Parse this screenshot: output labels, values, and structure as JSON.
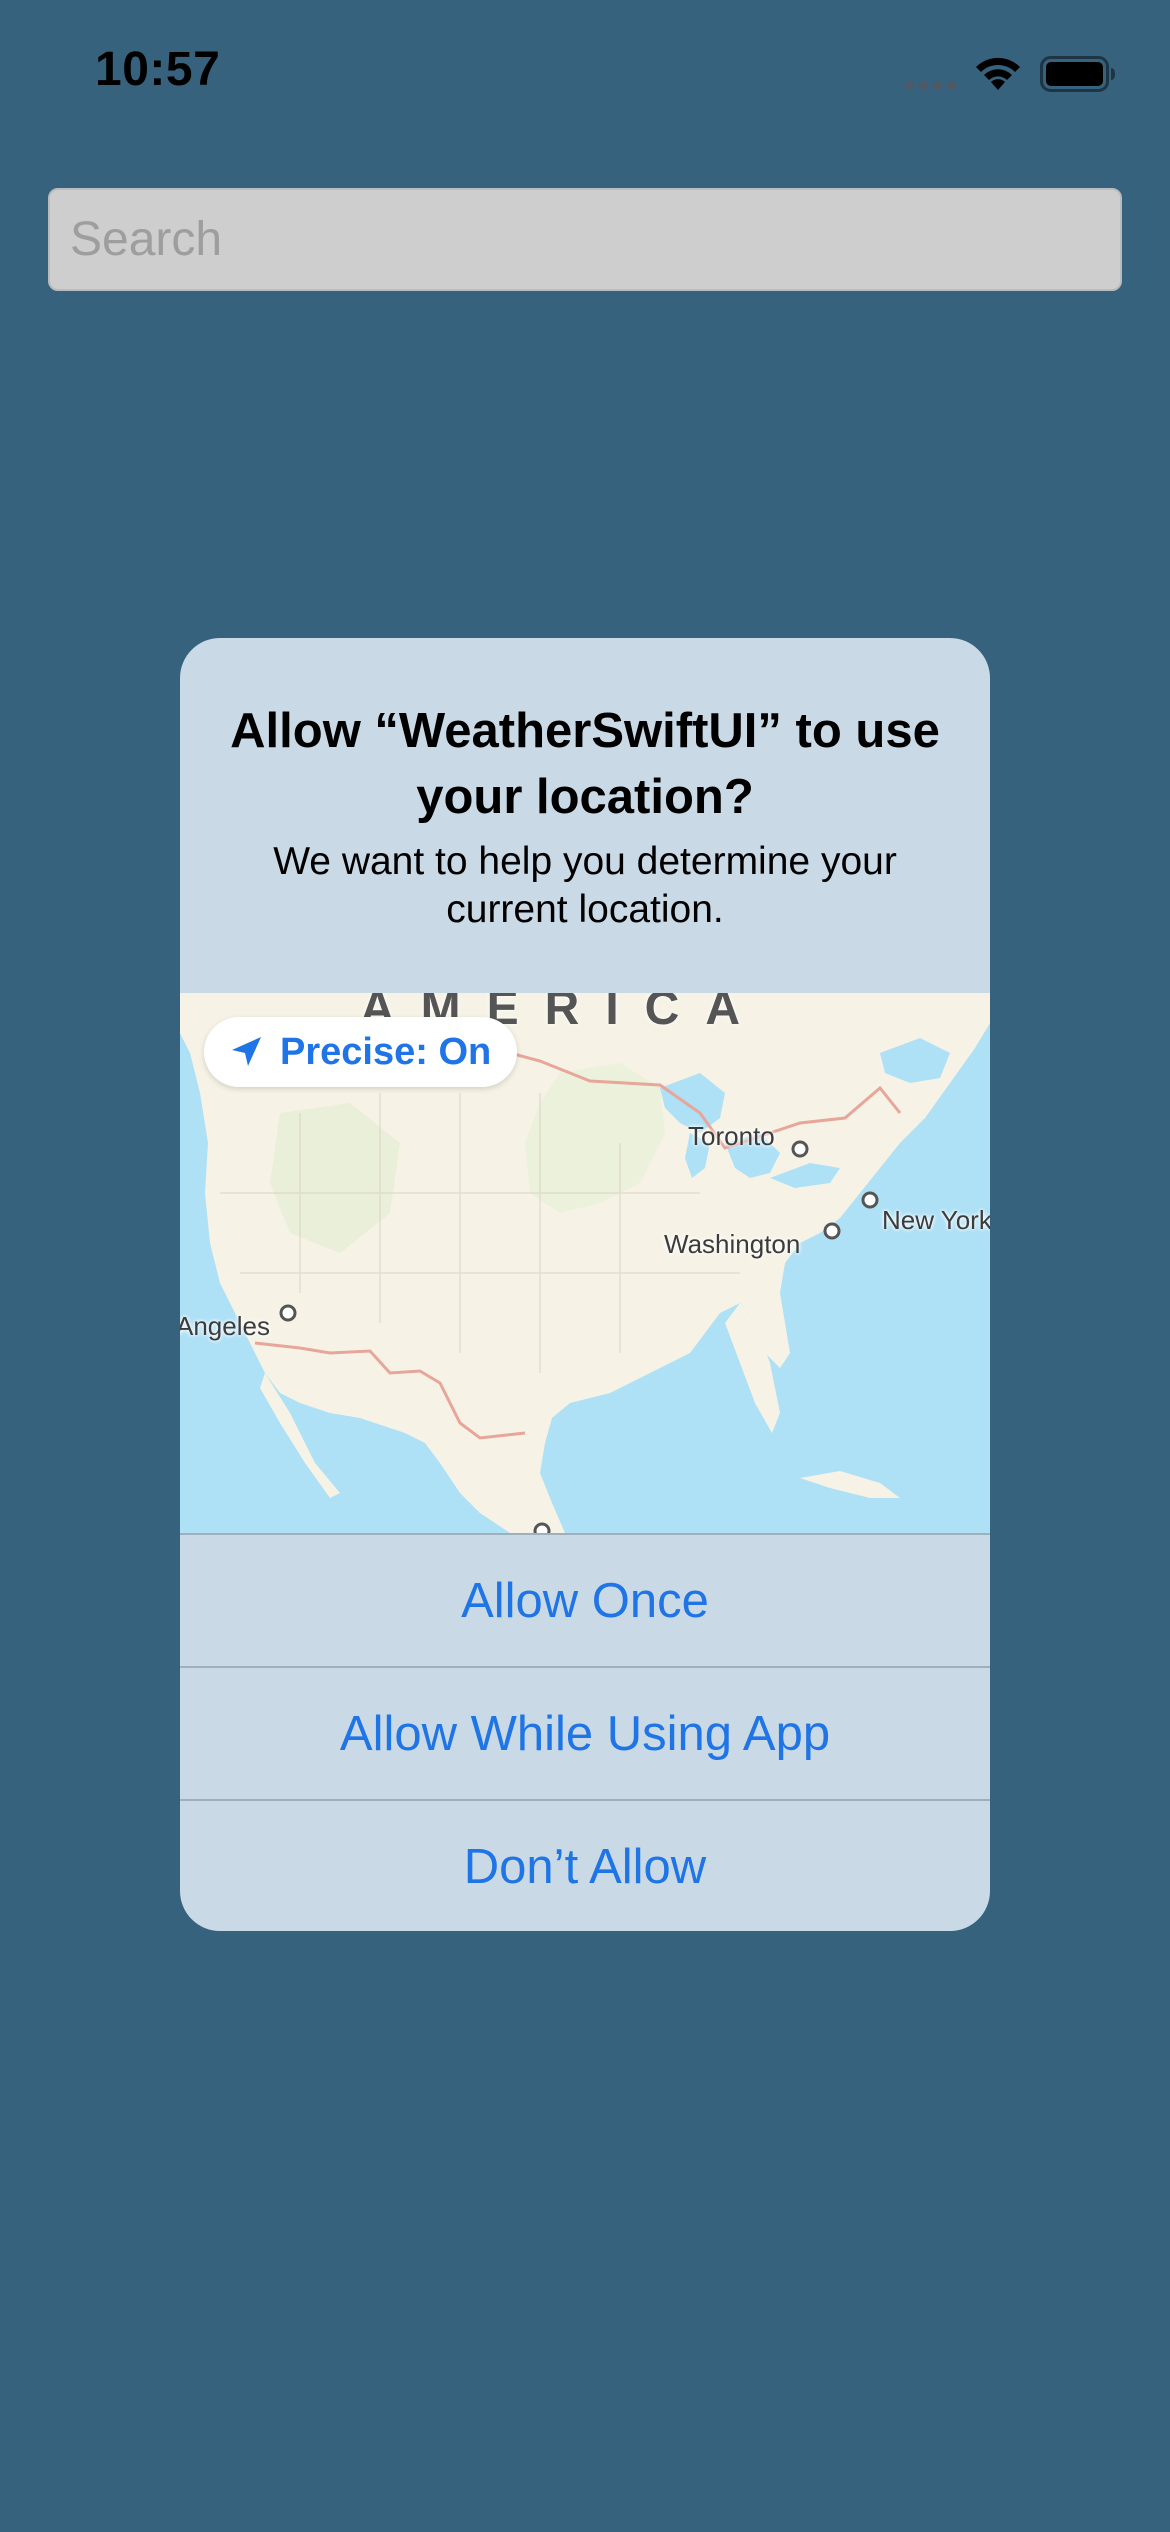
{
  "status_bar": {
    "time": "10:57",
    "icons": [
      "cellular-signal-icon",
      "wifi-icon",
      "battery-icon"
    ]
  },
  "search": {
    "placeholder": "Search",
    "value": ""
  },
  "alert": {
    "title": "Allow “WeatherSwiftUI” to use your location?",
    "message": "We want to help you determine your current location.",
    "map": {
      "region_label": "AMERICA",
      "precise_toggle": {
        "label": "Precise: On",
        "icon": "location-arrow-icon"
      },
      "places": [
        "Toronto",
        "New York",
        "Washington",
        "Angeles"
      ]
    },
    "buttons": {
      "allow_once": "Allow Once",
      "allow_while_using": "Allow While Using App",
      "dont_allow": "Don’t Allow"
    }
  },
  "colors": {
    "background": "#37627e",
    "alert_background": "#c9dae6",
    "accent": "#1f74e6",
    "water": "#aee0f6",
    "land": "#f6f3e6"
  }
}
